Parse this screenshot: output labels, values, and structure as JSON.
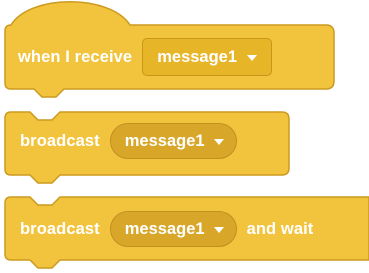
{
  "blocks": [
    {
      "kind": "hat",
      "label": "when I receive",
      "dropdown": {
        "value": "message1",
        "icon": "caret-down-icon"
      }
    },
    {
      "kind": "stack",
      "label": "broadcast",
      "dropdown": {
        "value": "message1",
        "icon": "caret-down-icon"
      }
    },
    {
      "kind": "stack",
      "label": "broadcast",
      "dropdown": {
        "value": "message1",
        "icon": "caret-down-icon"
      },
      "suffix": "and wait"
    }
  ],
  "colors": {
    "block_fill": "#f2c33c",
    "block_stroke": "#cc9a1f",
    "dropdown_fill": "#e7b528",
    "pill_fill": "#d8a72a",
    "text": "#ffffff"
  }
}
